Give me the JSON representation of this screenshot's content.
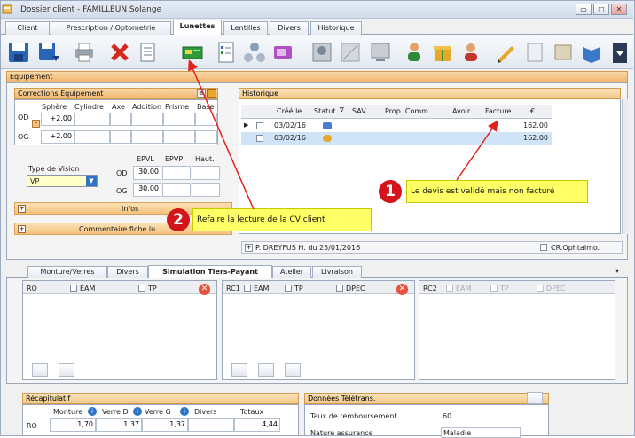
{
  "window": {
    "title": "Dossier client - FAMILLEUN Solange"
  },
  "tabs": [
    "Client",
    "Prescription / Optometrie",
    "Lunettes",
    "Lentilles",
    "Divers",
    "Historique"
  ],
  "active_tab": "Lunettes",
  "equipement": {
    "section_title": "Equipement",
    "corrections": {
      "title": "Corrections Equipement",
      "columns": [
        "Sphère",
        "Cylindre",
        "Axe",
        "Addition",
        "Prisme",
        "Base"
      ],
      "rows": [
        {
          "eye": "OD",
          "sphere": "+2.00"
        },
        {
          "eye": "OG",
          "sphere": "+2.00"
        }
      ]
    },
    "vision": {
      "type_label": "Type de Vision",
      "type_value": "VP",
      "headers": [
        "EPVL",
        "EPVP",
        "Haut."
      ],
      "od_label": "OD",
      "od_epvl": "30.00",
      "og_label": "OG",
      "og_epvl": "30.00"
    },
    "infos_label": "Infos",
    "commentaire_label": "Commentaire fiche lu"
  },
  "historique": {
    "title": "Historique",
    "columns": [
      "Créé le",
      "Statut",
      "SAV",
      "Prop. Comm.",
      "Avoir",
      "Facture",
      "€"
    ],
    "rows": [
      {
        "date": "03/02/16",
        "euro": "162.00"
      },
      {
        "date": "03/02/16",
        "euro": "162.00"
      }
    ],
    "prescriber": "P. DREYFUS H. du 25/01/2016",
    "cr_label": "CR.Ophtalmo."
  },
  "callouts": [
    {
      "number": "1",
      "text": "Le devis est validé mais non facturé"
    },
    {
      "number": "2",
      "text": "Refaire la lecture de la CV client"
    }
  ],
  "bottom_tabs": [
    "Monture/Verres",
    "Divers",
    "Simulation Tiers-Payant",
    "Atelier",
    "Livraison"
  ],
  "active_bottom_tab": "Simulation Tiers-Payant",
  "tp_panels": [
    {
      "id": "RO",
      "checks": [
        "EAM",
        "TP"
      ]
    },
    {
      "id": "RC1",
      "checks": [
        "EAM",
        "TP",
        "DPEC"
      ]
    },
    {
      "id": "RC2",
      "checks": [
        "EAM",
        "TP",
        "DPEC"
      ]
    }
  ],
  "recap": {
    "title": "Récapitulatif",
    "columns": [
      "Monture",
      "Verre D",
      "Verre G",
      "Divers",
      "Totaux"
    ],
    "row_label": "RO",
    "values": [
      "1,70",
      "1,37",
      "1,37",
      "",
      "4,44"
    ]
  },
  "teletrans": {
    "title": "Données Télétrans.",
    "taux_label": "Taux de remboursement",
    "taux_value": "60",
    "nature_label": "Nature assurance",
    "nature_value": "Maladie"
  },
  "colors": {
    "callout_bg": "#ffff66",
    "badge": "#d4141b",
    "arrow": "#e3201b",
    "section": "#f1b871"
  }
}
